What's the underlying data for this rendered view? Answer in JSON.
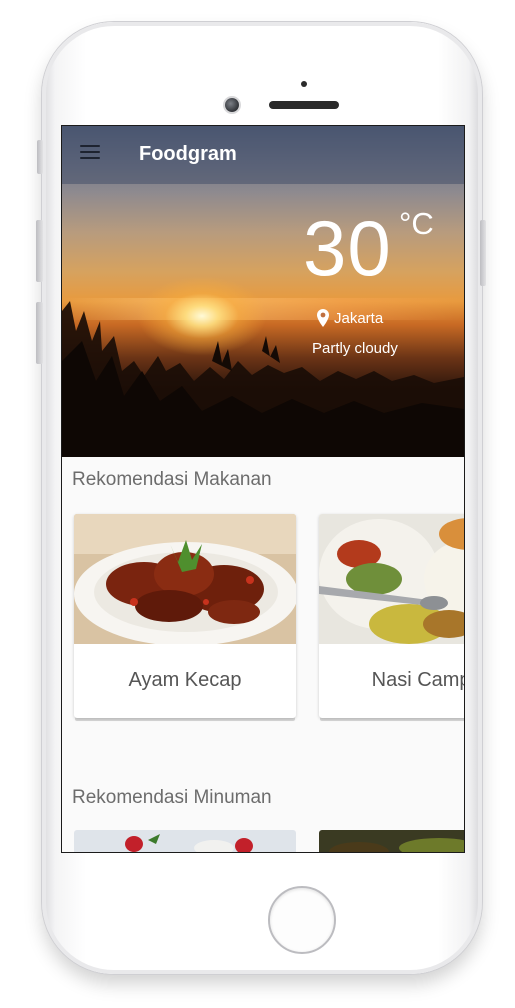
{
  "app": {
    "title": "Foodgram"
  },
  "weather": {
    "temperature": "30",
    "unit": "°C",
    "location": "Jakarta",
    "condition": "Partly cloudy"
  },
  "sections": {
    "food_title": "Rekomendasi Makanan",
    "drink_title": "Rekomendasi Minuman"
  },
  "food_items": [
    {
      "name": "Ayam Kecap"
    },
    {
      "name": "Nasi Campur"
    }
  ],
  "icons": {
    "menu": "hamburger-menu-icon",
    "location": "location-pin-icon"
  },
  "colors": {
    "appbar_overlay": "#46506980",
    "section_title": "#6c6c6c",
    "card_label": "#555555",
    "screen_background": "#fafafa"
  }
}
